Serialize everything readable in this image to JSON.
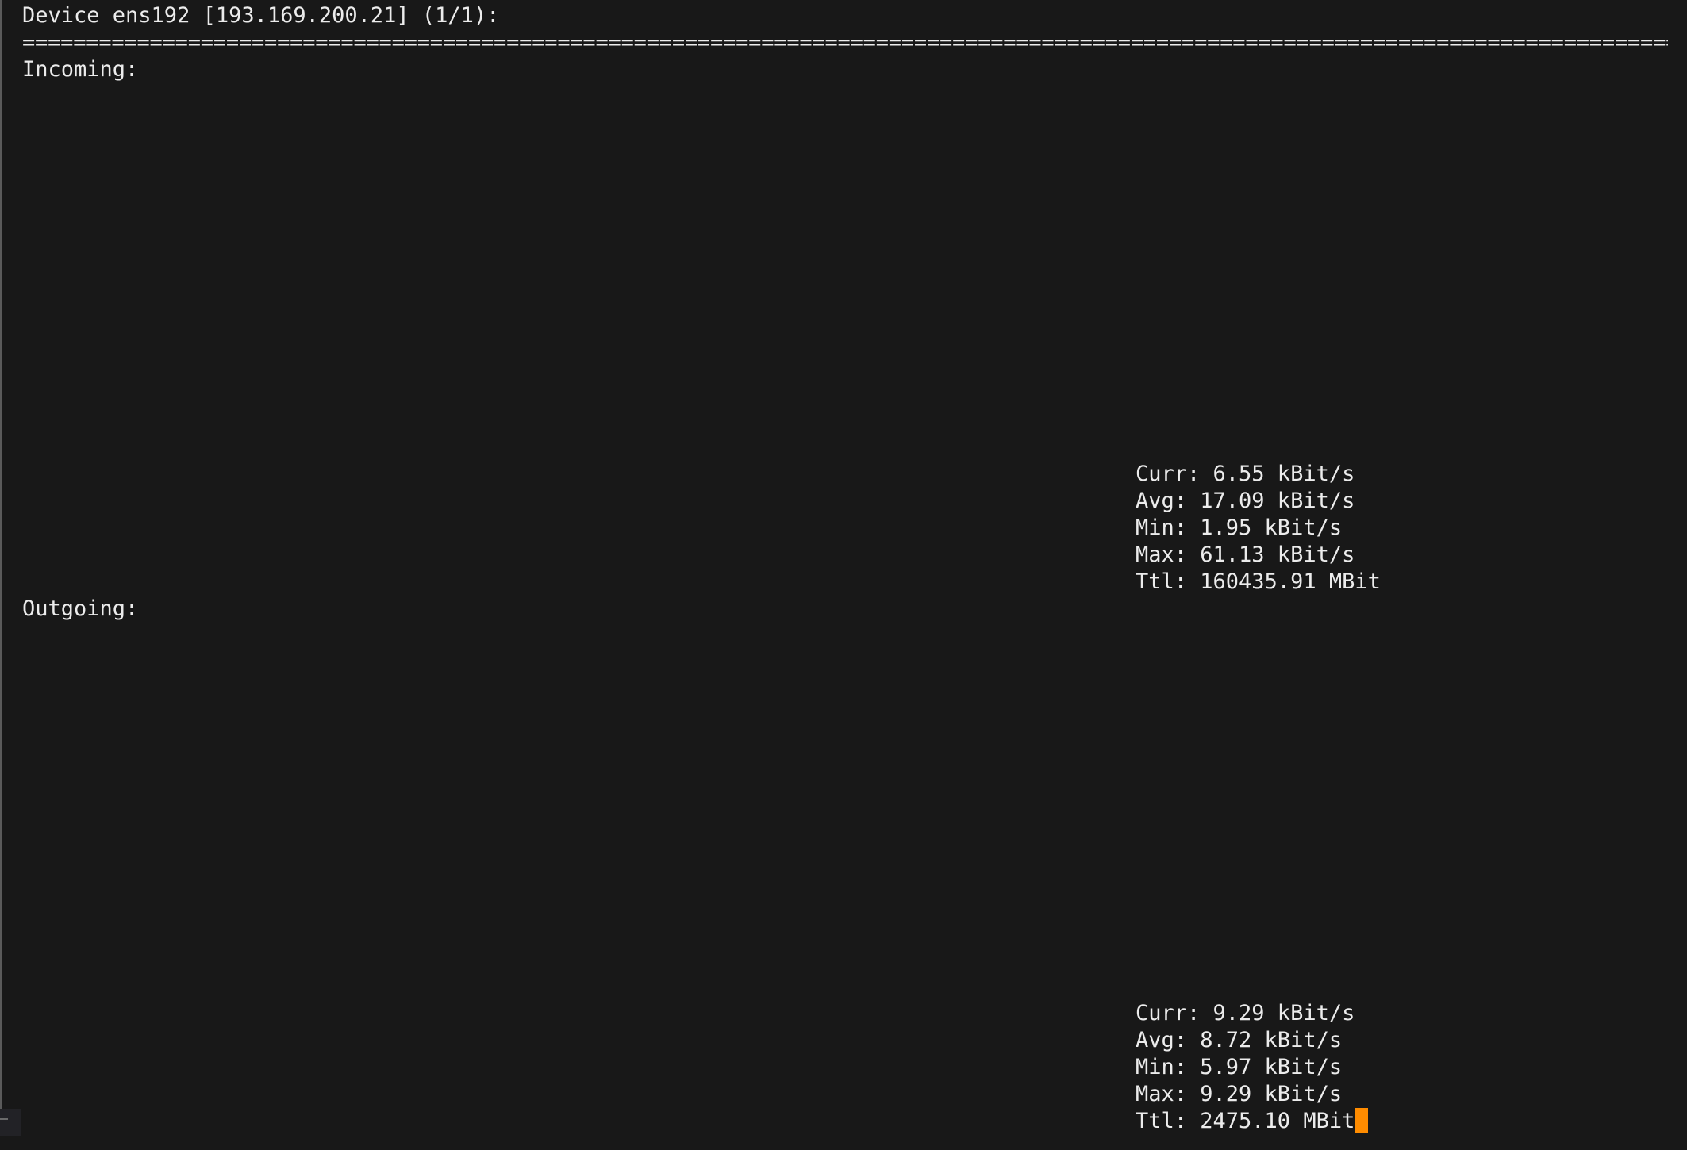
{
  "header": {
    "title": "Device ens192 [193.169.200.21] (1/1):",
    "separator": "=============================================================================================================================================================================================================="
  },
  "incoming": {
    "label": "Incoming:",
    "stats": [
      "Curr: 6.55 kBit/s",
      "Avg: 17.09 kBit/s",
      "Min: 1.95 kBit/s",
      "Max: 61.13 kBit/s",
      "Ttl: 160435.91 MBit"
    ]
  },
  "outgoing": {
    "label": "Outgoing:",
    "stats": [
      "Curr: 9.29 kBit/s",
      "Avg: 8.72 kBit/s",
      "Min: 5.97 kBit/s",
      "Max: 9.29 kBit/s",
      "Ttl: 2475.10 MBit"
    ]
  },
  "colors": {
    "background": "#181818",
    "text": "#ececec",
    "cursor": "#ff8c00"
  }
}
